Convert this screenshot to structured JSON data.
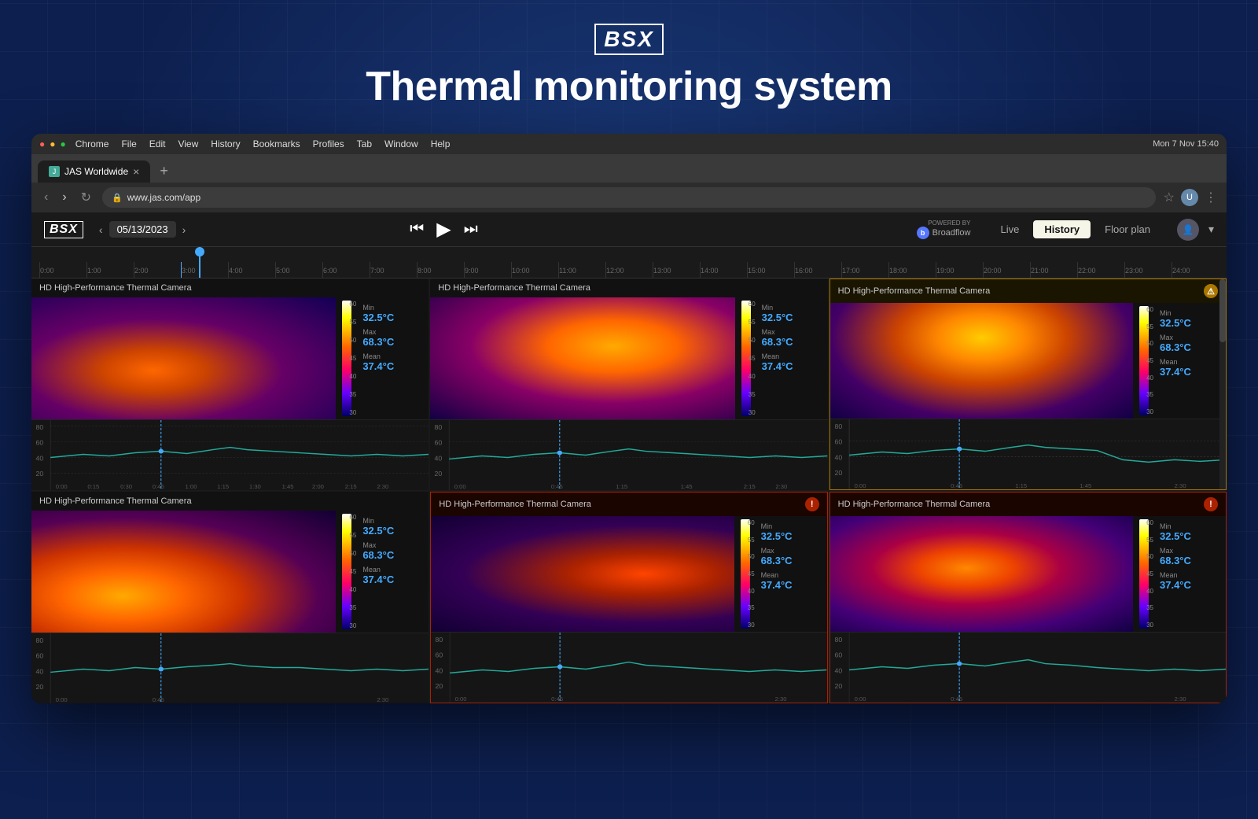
{
  "page": {
    "title": "Thermal monitoring system",
    "brand": "BSX"
  },
  "browser": {
    "tab_title": "JAS Worldwide",
    "url": "www.jas.com/app",
    "menu_items": [
      "Chrome",
      "File",
      "Edit",
      "View",
      "History",
      "Bookmarks",
      "Profiles",
      "Tab",
      "Window",
      "Help"
    ],
    "datetime": "Mon 7 Nov  15:40",
    "nav_back": "‹",
    "nav_forward": "›",
    "nav_refresh": "↻",
    "new_tab": "+"
  },
  "app": {
    "logo": "BSX",
    "date": "05/13/2023",
    "powered_by_label": "POWERED BY",
    "powered_by_brand": "Broadflow",
    "view_tabs": [
      "Live",
      "History",
      "Floor plan"
    ],
    "active_tab": "History",
    "timeline_labels": [
      "0:00",
      "1:00",
      "2:00",
      "3:00",
      "4:00",
      "5:00",
      "6:00",
      "7:00",
      "8:00",
      "9:00",
      "10:00",
      "11:00",
      "12:00",
      "13:00",
      "14:00",
      "15:00",
      "16:00",
      "17:00",
      "18:00",
      "19:00",
      "20:00",
      "21:00",
      "22:00",
      "23:00",
      "24:00"
    ]
  },
  "cameras": [
    {
      "id": 1,
      "title": "HD High-Performance Thermal Camera",
      "status": "normal",
      "temp_min": "32.5°C",
      "temp_max": "68.3°C",
      "temp_mean": "37.4°C",
      "thermal_class": "thermal-sim-1"
    },
    {
      "id": 2,
      "title": "HD High-Performance Thermal Camera",
      "status": "normal",
      "temp_min": "32.5°C",
      "temp_max": "68.3°C",
      "temp_mean": "37.4°C",
      "thermal_class": "thermal-sim-2"
    },
    {
      "id": 3,
      "title": "HD High-Performance Thermal Camera",
      "status": "warning",
      "temp_min": "32.5°C",
      "temp_max": "68.3°C",
      "temp_mean": "37.4°C",
      "thermal_class": "thermal-sim-3"
    },
    {
      "id": 4,
      "title": "HD High-Performance Thermal Camera",
      "status": "normal",
      "temp_min": "32.5°C",
      "temp_max": "68.3°C",
      "temp_mean": "37.4°C",
      "thermal_class": "thermal-sim-4"
    },
    {
      "id": 5,
      "title": "HD High-Performance Thermal Camera",
      "status": "alert",
      "temp_min": "32.5°C",
      "temp_max": "68.3°C",
      "temp_mean": "37.4°C",
      "thermal_class": "thermal-sim-5"
    },
    {
      "id": 6,
      "title": "HD High-Performance Thermal Camera",
      "status": "alert",
      "temp_min": "32.5°C",
      "temp_max": "68.3°C",
      "temp_mean": "37.4°C",
      "thermal_class": "thermal-sim-6"
    }
  ],
  "chart": {
    "y_labels": [
      "80",
      "60",
      "40",
      "20"
    ],
    "x_labels": [
      "0:00",
      "0:15",
      "0:30",
      "0:45",
      "1:00",
      "1:15",
      "1:30",
      "1:45",
      "2:00",
      "2:15",
      "2:30"
    ],
    "cursor_x": "0:45"
  },
  "scale_labels": [
    "60",
    "55",
    "50",
    "45",
    "40",
    "35",
    "30"
  ]
}
